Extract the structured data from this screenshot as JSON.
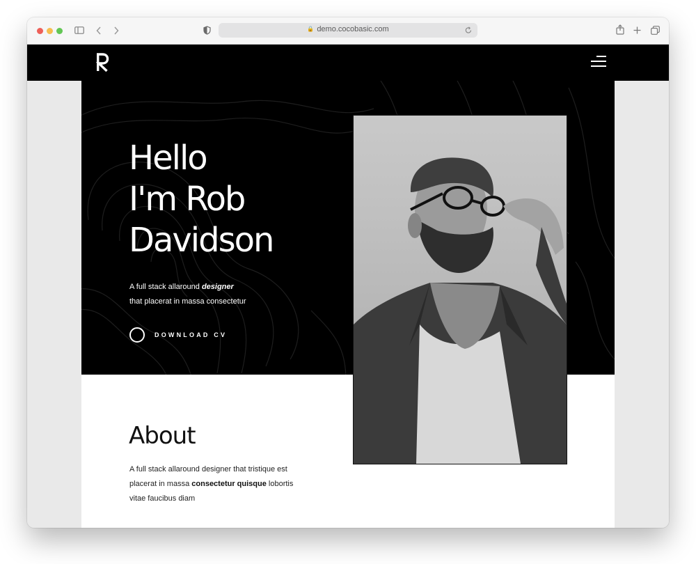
{
  "browser": {
    "url": "demo.cocobasic.com",
    "traffic_lights": {
      "close": "#ee5f58",
      "minimize": "#f6be4f",
      "zoom": "#62c654"
    },
    "icons": {
      "sidebar": "sidebar-icon",
      "back": "chevron-left-icon",
      "forward": "chevron-right-icon",
      "shield": "shield-icon",
      "lock": "lock-icon",
      "reload": "reload-icon",
      "share": "share-icon",
      "new_tab": "plus-icon",
      "tabs": "tabs-overview-icon"
    }
  },
  "site": {
    "logo_letter": "R",
    "menu_icon": "hamburger-menu-icon",
    "hero": {
      "title_lines": [
        "Hello",
        "I'm Rob",
        "Davidson"
      ],
      "subtitle_line1_prefix": "A full stack allaround ",
      "subtitle_highlight": "designer",
      "subtitle_line2": "that placerat in massa consectetur",
      "cta_label": "DOWNLOAD CV"
    },
    "about": {
      "title": "About",
      "text_part1": "A full stack allaround designer that tristique est placerat in massa ",
      "text_bold1": "consectetur quisque",
      "text_part2": " lobortis vitae faucibus diam"
    },
    "portrait": "portrait-photo-man-with-glasses"
  }
}
